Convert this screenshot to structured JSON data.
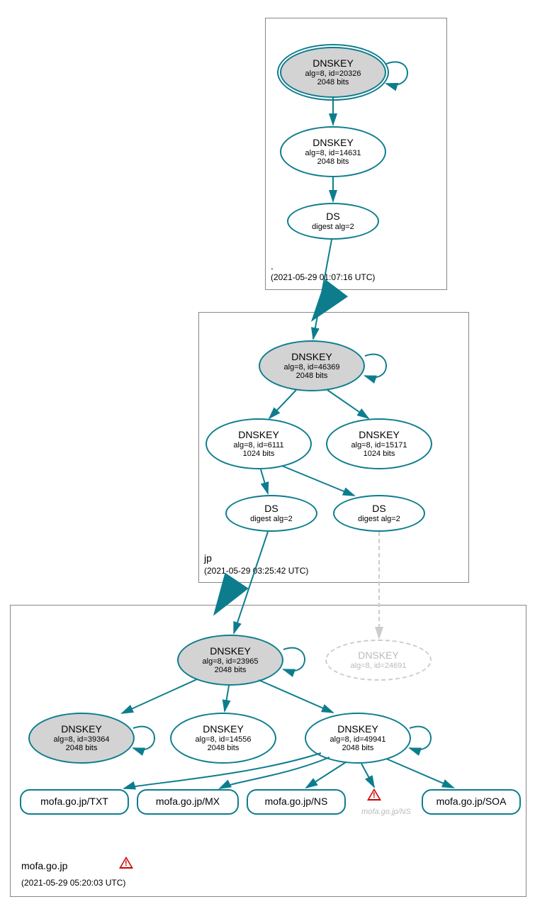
{
  "zones": {
    "root": {
      "label": ".",
      "timestamp": "(2021-05-29 01:07:16 UTC)"
    },
    "jp": {
      "label": "jp",
      "timestamp": "(2021-05-29 03:25:42 UTC)"
    },
    "mofa": {
      "label": "mofa.go.jp",
      "timestamp": "(2021-05-29 05:20:03 UTC)"
    }
  },
  "nodes": {
    "root_ksk": {
      "title": "DNSKEY",
      "sub": "alg=8, id=20326",
      "sub2": "2048 bits"
    },
    "root_zsk": {
      "title": "DNSKEY",
      "sub": "alg=8, id=14631",
      "sub2": "2048 bits"
    },
    "root_ds": {
      "title": "DS",
      "sub": "digest alg=2"
    },
    "jp_ksk": {
      "title": "DNSKEY",
      "sub": "alg=8, id=46369",
      "sub2": "2048 bits"
    },
    "jp_zsk1": {
      "title": "DNSKEY",
      "sub": "alg=8, id=6111",
      "sub2": "1024 bits"
    },
    "jp_zsk2": {
      "title": "DNSKEY",
      "sub": "alg=8, id=15171",
      "sub2": "1024 bits"
    },
    "jp_ds1": {
      "title": "DS",
      "sub": "digest alg=2"
    },
    "jp_ds2": {
      "title": "DS",
      "sub": "digest alg=2"
    },
    "mofa_ksk": {
      "title": "DNSKEY",
      "sub": "alg=8, id=23965",
      "sub2": "2048 bits"
    },
    "mofa_grey": {
      "title": "DNSKEY",
      "sub": "alg=8, id=24691"
    },
    "mofa_k2": {
      "title": "DNSKEY",
      "sub": "alg=8, id=39364",
      "sub2": "2048 bits"
    },
    "mofa_k3": {
      "title": "DNSKEY",
      "sub": "alg=8, id=14556",
      "sub2": "2048 bits"
    },
    "mofa_k4": {
      "title": "DNSKEY",
      "sub": "alg=8, id=49941",
      "sub2": "2048 bits"
    },
    "rr_txt": {
      "title": "mofa.go.jp/TXT"
    },
    "rr_mx": {
      "title": "mofa.go.jp/MX"
    },
    "rr_ns": {
      "title": "mofa.go.jp/NS"
    },
    "rr_ns_grey": {
      "title": "mofa.go.jp/NS"
    },
    "rr_soa": {
      "title": "mofa.go.jp/SOA"
    }
  }
}
